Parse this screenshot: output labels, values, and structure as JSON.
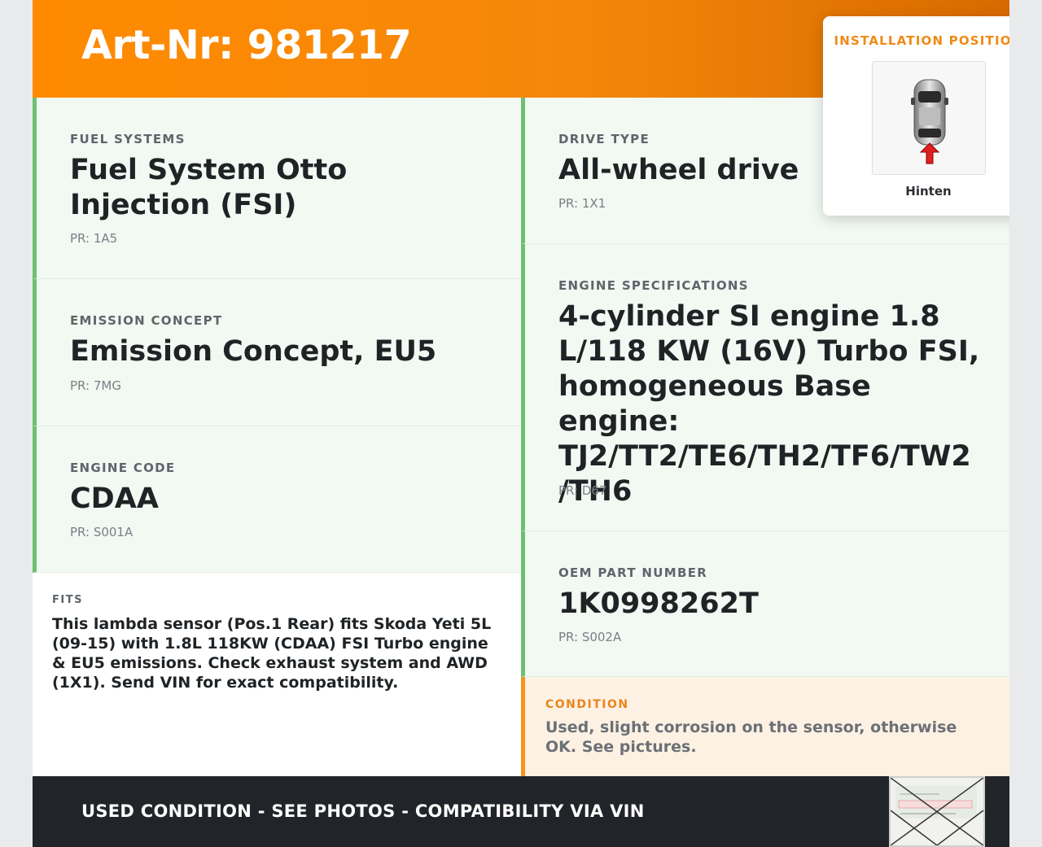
{
  "header": {
    "title": "Art-Nr: 981217"
  },
  "left_fields": [
    {
      "label": "FUEL SYSTEMS",
      "value": "Fuel System Otto Injection (FSI)",
      "pr": "PR: 1A5"
    },
    {
      "label": "EMISSION CONCEPT",
      "value": "Emission Concept, EU5",
      "pr": "PR: 7MG"
    },
    {
      "label": "ENGINE CODE",
      "value": "CDAA",
      "pr": "PR: S001A"
    }
  ],
  "right_fields": [
    {
      "label": "DRIVE TYPE",
      "value": "All-wheel drive",
      "pr": "PR: 1X1"
    },
    {
      "label": "ENGINE SPECIFICATIONS",
      "value": "4-cylinder SI engine 1.8 L/118 KW (16V) Turbo FSI, homogeneous Base engine: TJ2/TT2/TE6/TH2/TF6/TW2 /TH6",
      "pr": "PR: D67"
    },
    {
      "label": "OEM PART NUMBER",
      "value": "1K0998262T",
      "pr": "PR: S002A"
    }
  ],
  "fits": {
    "label": "FITS",
    "text": "This lambda sensor (Pos.1 Rear) fits Skoda Yeti 5L (09-15) with 1.8L 118KW (CDAA) FSI Turbo engine & EU5 emissions. Check exhaust system and AWD (1X1). Send VIN for exact compatibility."
  },
  "condition": {
    "label": "CONDITION",
    "text": "Used, slight corrosion on the sensor, otherwise OK. See pictures."
  },
  "footer": {
    "text": "USED CONDITION - SEE PHOTOS - COMPATIBILITY VIA VIN"
  },
  "installation": {
    "title": "INSTALLATION POSITION",
    "caption": "Hinten",
    "icon": "car-top-view-rear-arrow"
  },
  "colors": {
    "accent": "#ff8a00",
    "green_border": "#6cc070",
    "footer_bg": "#212428",
    "condition_bg": "#fdf1e3"
  }
}
